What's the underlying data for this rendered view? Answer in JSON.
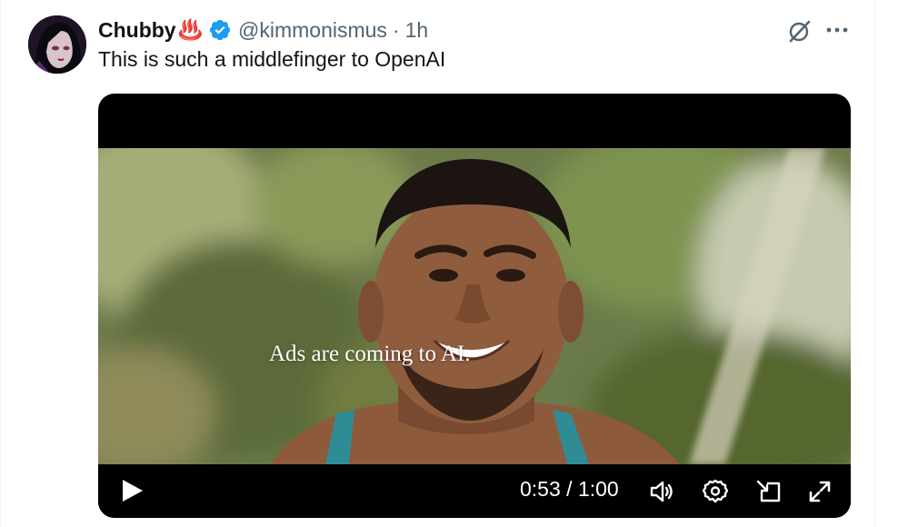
{
  "tweet": {
    "author_name": "Chubby",
    "author_emoji": "♨️",
    "handle": "@kimmonismus",
    "separator": "·",
    "time_ago": "1h",
    "text": "This is such a middlefinger to OpenAI"
  },
  "video": {
    "caption": "Ads are coming to AI.",
    "current_time": "0:53",
    "duration": "1:00",
    "progress_fraction": 0.883
  },
  "colors": {
    "verified": "#1d9bf0",
    "muted_text": "#536471",
    "primary_text": "#0f1419"
  },
  "icons": {
    "verified": "verified-badge-icon",
    "grok": "grok-icon",
    "more": "more-icon",
    "play": "play-icon",
    "volume": "volume-icon",
    "settings": "gear-icon",
    "dock": "picture-in-picture-icon",
    "fullscreen": "fullscreen-icon"
  }
}
